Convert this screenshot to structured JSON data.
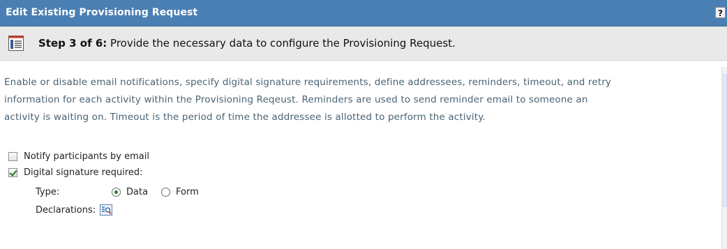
{
  "header": {
    "title": "Edit Existing Provisioning Request",
    "help_label": "?"
  },
  "step": {
    "step_prefix": "Step 3 of 6:",
    "step_text": "Provide the necessary data to configure the Provisioning Request."
  },
  "description": {
    "line1": "Enable or disable email notifications, specify digital signature requirements, define addressees, reminders, timeout, and retry",
    "line2": "information for each activity within the Provisioning Reqeust.  Reminders are used to send reminder email to someone an",
    "line3": "activity is waiting on.  Timeout is the period of time the addressee is allotted to perform the activity."
  },
  "options": {
    "notify_label": "Notify participants by email",
    "notify_checked": false,
    "signature_label": "Digital signature required:",
    "signature_checked": true,
    "type_label": "Type:",
    "type_option_data": "Data",
    "type_option_form": "Form",
    "type_selected": "Data",
    "declarations_label": "Declarations:"
  },
  "colors": {
    "title_bar": "#4a7fb3",
    "step_bar": "#e9e9e9",
    "description_text": "#4a6374"
  },
  "icons": {
    "help": "help-icon",
    "step": "wizard-step-icon",
    "declarations": "declarations-lookup-icon"
  }
}
